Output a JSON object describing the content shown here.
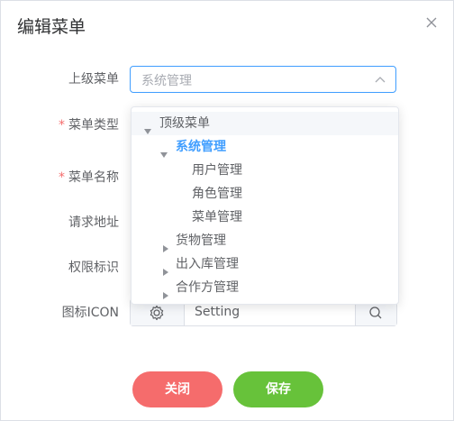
{
  "dialog": {
    "title": "编辑菜单"
  },
  "form": {
    "parent_menu_label": "上级菜单",
    "parent_menu_placeholder": "系统管理",
    "menu_type_label": "菜单类型",
    "menu_name_label": "菜单名称",
    "request_url_label": "请求地址",
    "permission_label": "权限标识",
    "icon_label": "图标ICON",
    "icon_value": "Setting",
    "required_mark": "*"
  },
  "tree": {
    "nodes": [
      {
        "label": "顶级菜单",
        "level": 0,
        "expanded": true
      },
      {
        "label": "系统管理",
        "level": 1,
        "expanded": true,
        "selected": true
      },
      {
        "label": "用户管理",
        "level": 2
      },
      {
        "label": "角色管理",
        "level": 2
      },
      {
        "label": "菜单管理",
        "level": 2
      },
      {
        "label": "货物管理",
        "level": 1,
        "expanded": false
      },
      {
        "label": "出入库管理",
        "level": 1,
        "expanded": false
      },
      {
        "label": "合作方管理",
        "level": 1,
        "expanded": false
      }
    ]
  },
  "buttons": {
    "close": "关闭",
    "save": "保存"
  },
  "icons": {
    "close": "close-icon",
    "select_arrow": "chevron-up-icon",
    "icon_prefix": "gear-icon",
    "icon_search": "search-icon",
    "caret_expanded": "caret-down-icon",
    "caret_collapsed": "caret-right-icon"
  },
  "colors": {
    "primary": "#409eff",
    "danger": "#f56c6c",
    "success": "#67c23a"
  }
}
